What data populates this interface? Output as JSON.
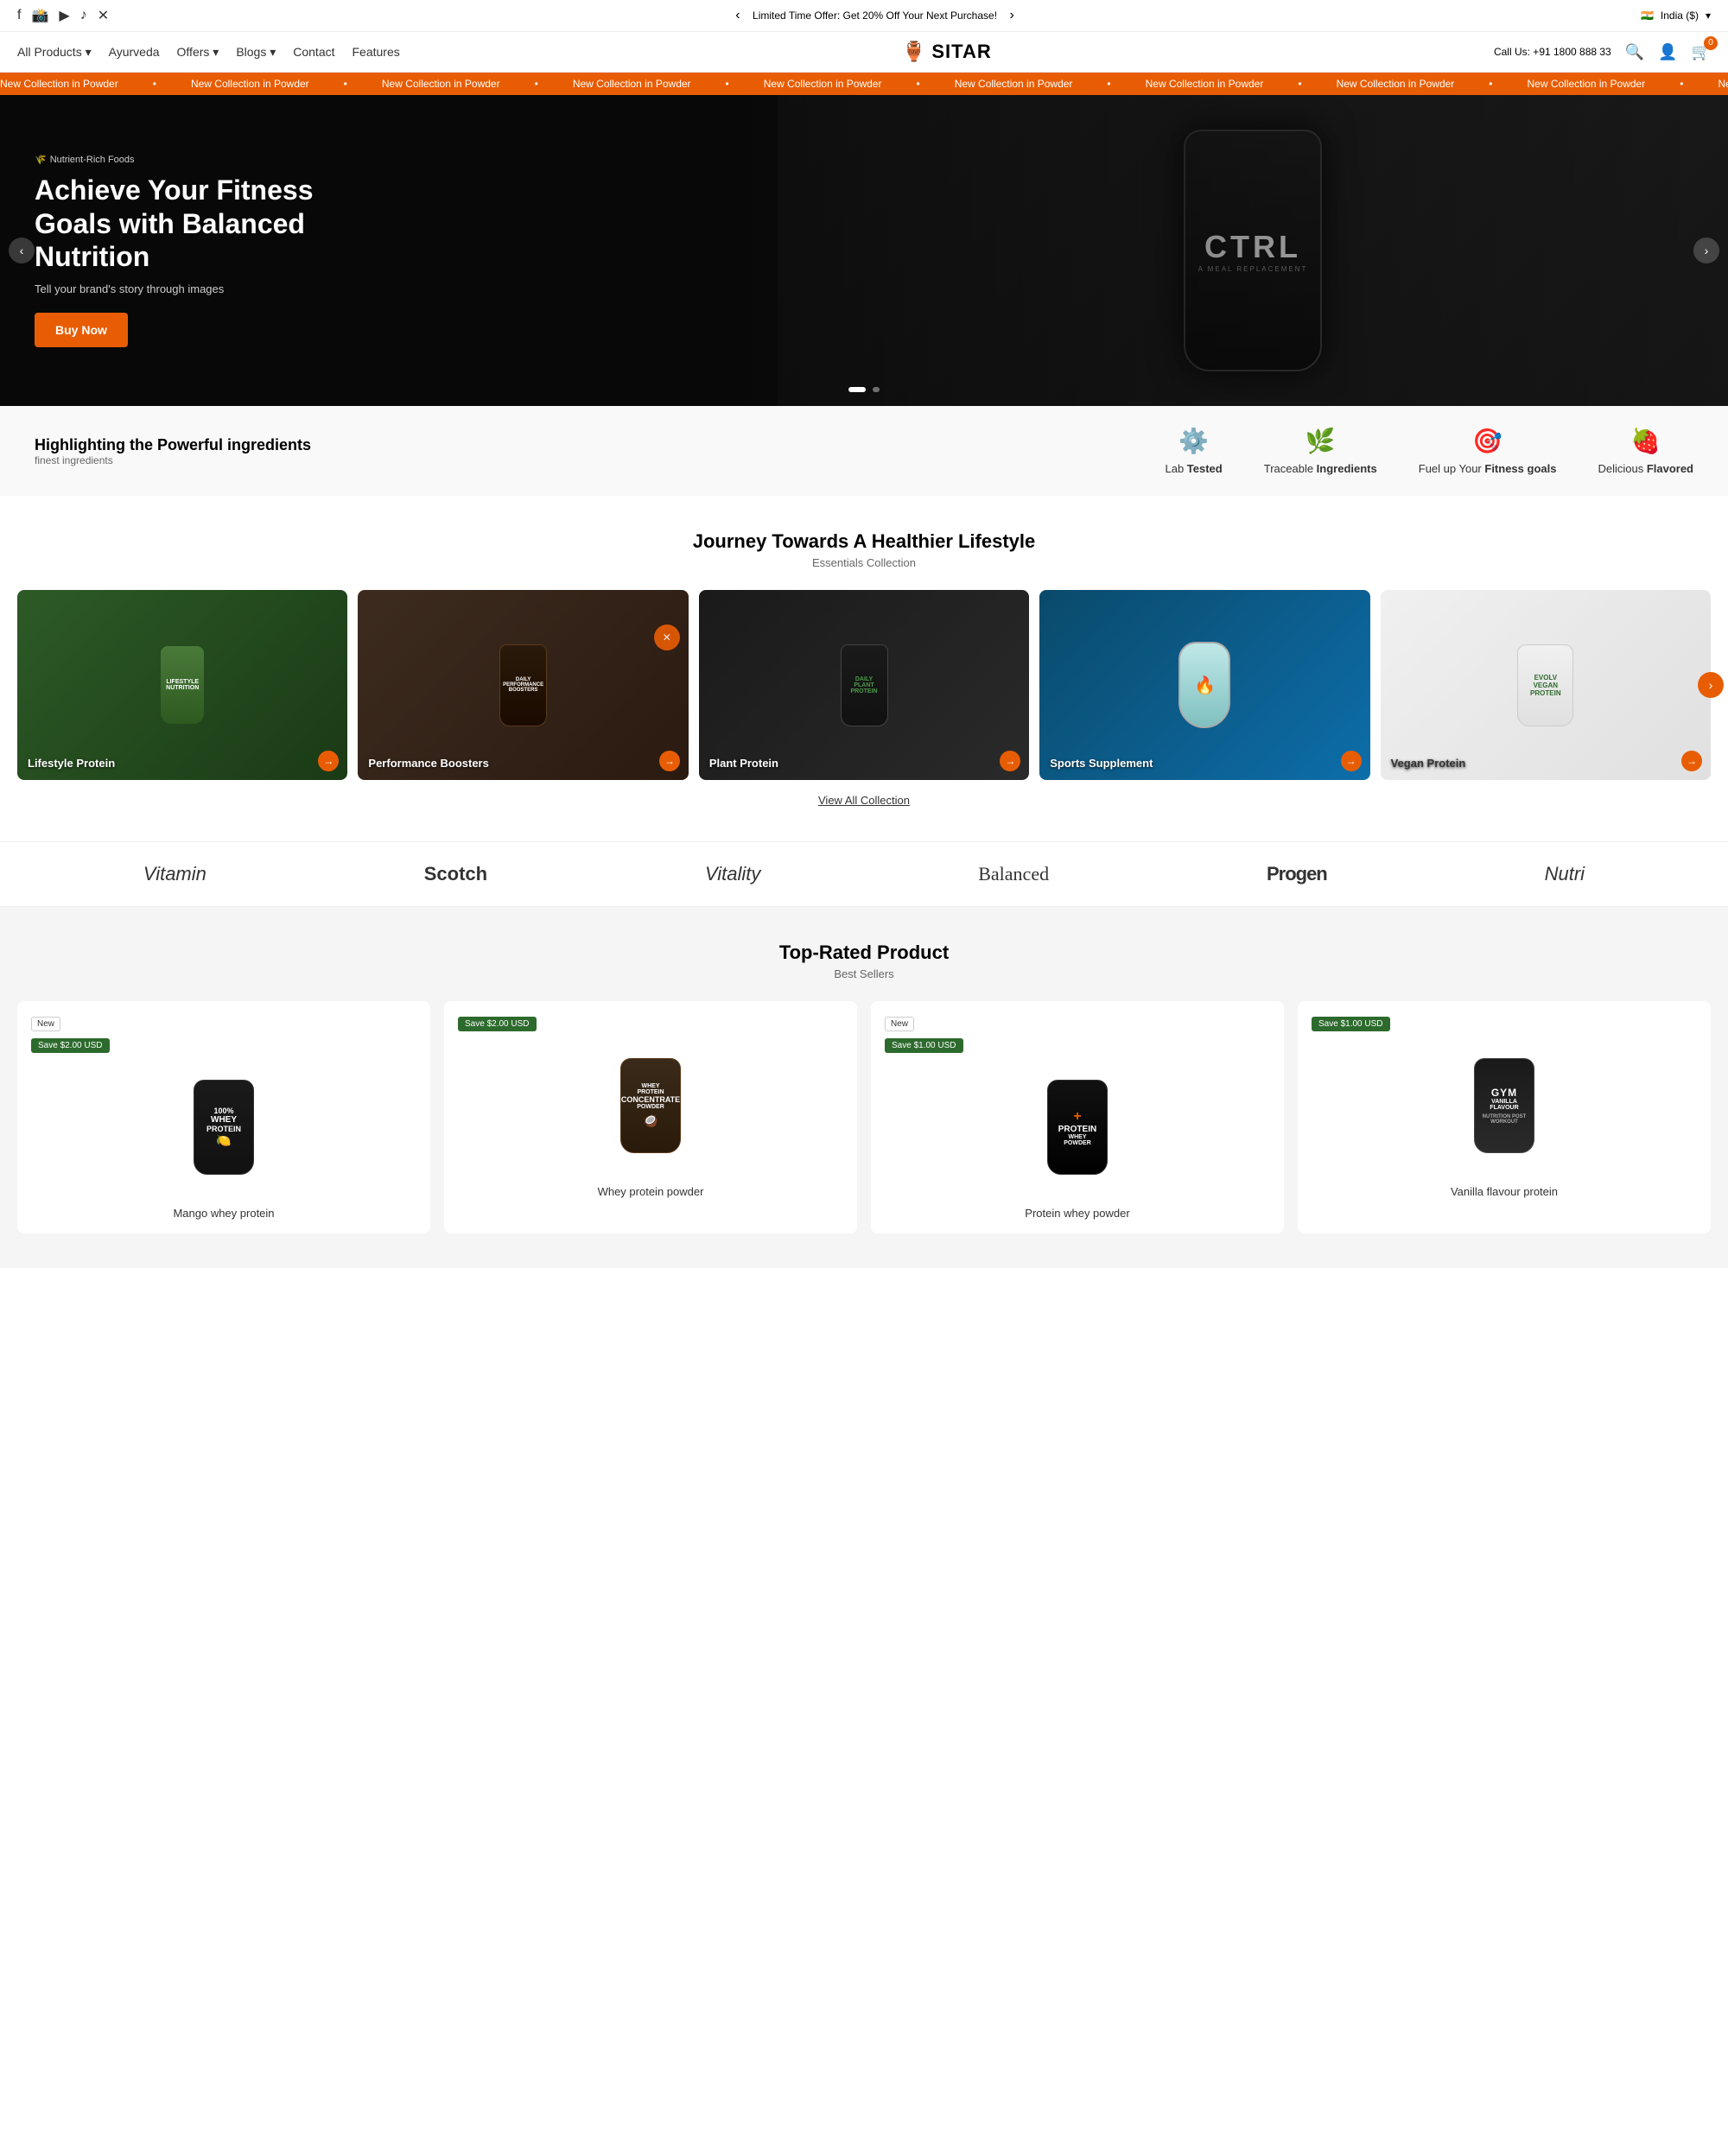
{
  "topbar": {
    "promo": "Limited Time Offer: Get 20% Off Your Next Purchase!",
    "region": "India ($)",
    "phone": "Call Us: +91 1800 888 33"
  },
  "nav": {
    "items": [
      {
        "label": "All Products",
        "hasDropdown": true
      },
      {
        "label": "Ayurveda",
        "hasDropdown": false
      },
      {
        "label": "Offers",
        "hasDropdown": true
      },
      {
        "label": "Blogs",
        "hasDropdown": true
      },
      {
        "label": "Contact",
        "hasDropdown": false
      },
      {
        "label": "Features",
        "hasDropdown": false
      }
    ],
    "logo": "SITAR",
    "cart_count": "0"
  },
  "ticker": {
    "items": [
      "New Collection in Powder",
      "New Collection in Powder",
      "New Collection in Powder",
      "New Collection in Powder",
      "New Collection in Powder",
      "New Collection in Powder",
      "New Collection in Powder",
      "New Collection in Powder"
    ]
  },
  "hero": {
    "badge": "Nutrient-Rich Foods",
    "title": "Achieve Your Fitness Goals with Balanced Nutrition",
    "subtitle": "Tell your brand's story through images",
    "cta": "Buy Now"
  },
  "features": {
    "heading_plain": "Highlighting the ",
    "heading_bold": "Powerful ingredients",
    "sub": "finest ingredients",
    "items": [
      {
        "icon": "⚙️",
        "label_plain": "Lab ",
        "label_bold": "Tested"
      },
      {
        "icon": "🌿",
        "label_plain": "Traceable ",
        "label_bold": "Ingredients"
      },
      {
        "icon": "🎯",
        "label_plain": "Fuel up Your ",
        "label_bold": "Fitness goals"
      },
      {
        "icon": "🍓",
        "label_plain": "Delicious ",
        "label_bold": "Flavored"
      }
    ]
  },
  "collection": {
    "title": "Journey Towards A Healthier Lifestyle",
    "subtitle": "Essentials Collection",
    "view_all": "View All Collection",
    "items": [
      {
        "label": "Lifestyle Protein",
        "color_class": "col-lifestyle"
      },
      {
        "label": "Performance Boosters",
        "color_class": "col-performance"
      },
      {
        "label": "Plant Protein",
        "color_class": "col-plant"
      },
      {
        "label": "Sports Supplement",
        "color_class": "col-sports"
      },
      {
        "label": "Vegan Protein",
        "color_class": "col-vegan"
      }
    ]
  },
  "brands": {
    "items": [
      {
        "name": "Vitamin",
        "style": "italic"
      },
      {
        "name": "Scotch",
        "style": "bold"
      },
      {
        "name": "Vitality",
        "style": "italic"
      },
      {
        "name": "Balanced",
        "style": "serif"
      },
      {
        "name": "Progen",
        "style": "black"
      },
      {
        "name": "Nutri",
        "style": "italic"
      }
    ]
  },
  "top_products": {
    "title": "Top-Rated Product",
    "subtitle": "Best Sellers",
    "items": [
      {
        "badge_type": "new",
        "badge_label": "New",
        "save_label": "Save $2.00 USD",
        "name": "Mango whey protein",
        "bottle_type": "dark",
        "lines": [
          "100%",
          "WHEY",
          "PROTEIN"
        ]
      },
      {
        "badge_type": "save",
        "save_label": "Save $2.00 USD",
        "name": "Whey protein powder",
        "bottle_type": "brown",
        "lines": [
          "WHEY PROTEIN",
          "CONCENTRATE",
          "POWDER"
        ]
      },
      {
        "badge_type": "new",
        "badge_label": "New",
        "save_label": "Save $1.00 USD",
        "name": "Protein whey powder",
        "bottle_type": "black",
        "lines": [
          "PROTEIN",
          "WHEY POWDER"
        ]
      },
      {
        "badge_type": "save",
        "save_label": "Save $1.00 USD",
        "name": "Vanilla flavour protein",
        "bottle_type": "gray",
        "lines": [
          "GYM",
          "VANILLA FLAVOUR"
        ]
      }
    ]
  }
}
